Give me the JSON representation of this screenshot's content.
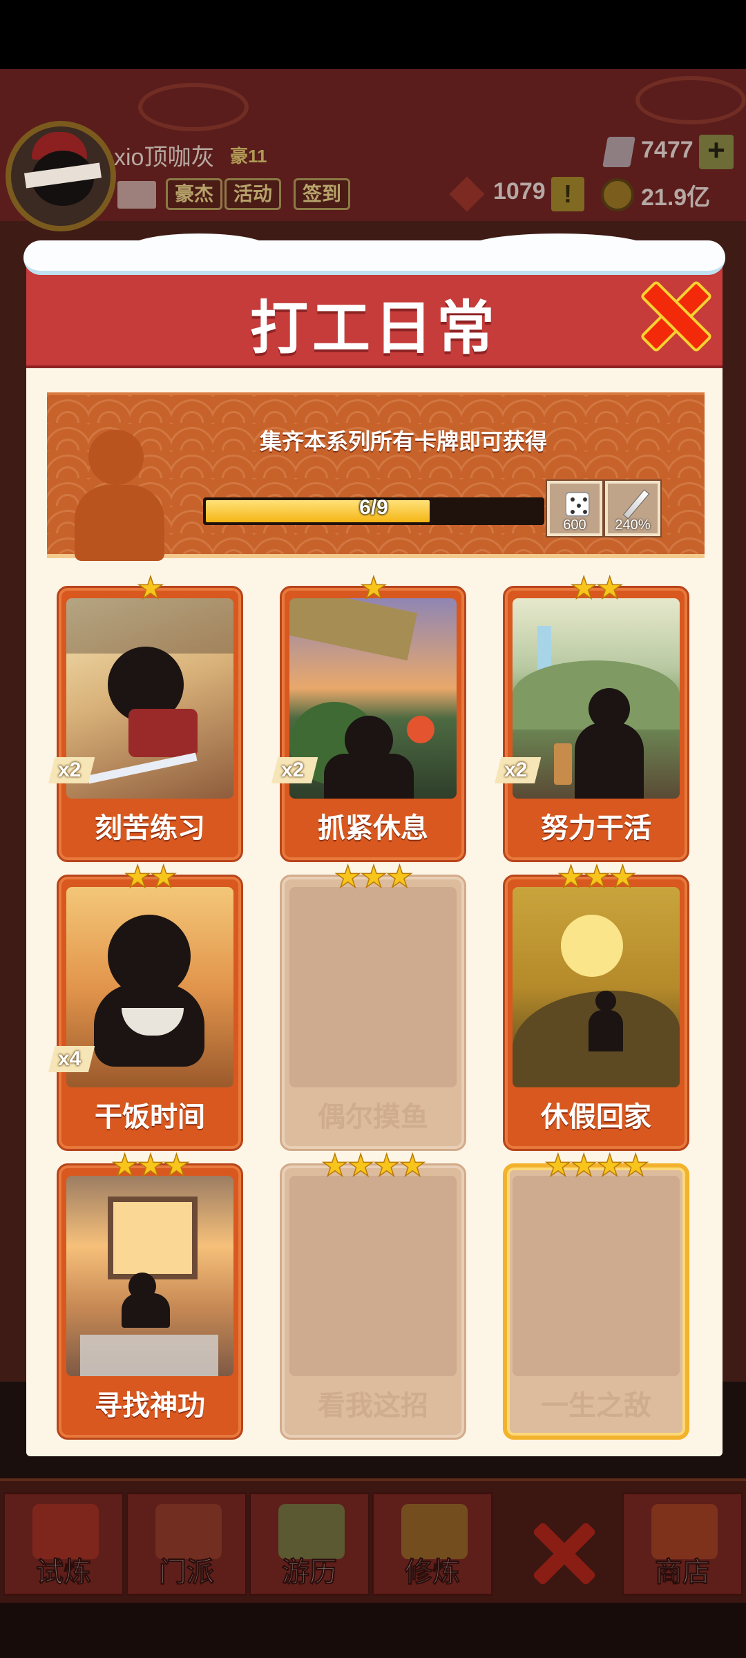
{
  "player": {
    "name": "xio顶咖灰",
    "rank": "豪11",
    "buttons": [
      "豪杰",
      "活动",
      "签到"
    ],
    "gems": "7477",
    "tokens": "1079",
    "gold": "21.9亿"
  },
  "modal": {
    "title": "打工日常",
    "banner_text": "集齐本系列所有卡牌即可获得",
    "progress": {
      "text": "6/9",
      "value": 6,
      "max": 9
    },
    "rewards": [
      {
        "icon": "dice-icon",
        "value": "600"
      },
      {
        "icon": "sword-icon",
        "value": "240%"
      }
    ],
    "cards": [
      {
        "name": "刻苦练习",
        "stars": "★",
        "count": "x2",
        "locked": false
      },
      {
        "name": "抓紧休息",
        "stars": "★",
        "count": "x2",
        "locked": false
      },
      {
        "name": "努力干活",
        "stars": "★★",
        "count": "x2",
        "locked": false
      },
      {
        "name": "干饭时间",
        "stars": "★★",
        "count": "x4",
        "locked": false
      },
      {
        "name": "偶尔摸鱼",
        "stars": "★★★",
        "count": "",
        "locked": true
      },
      {
        "name": "休假回家",
        "stars": "★★★",
        "count": "",
        "locked": false
      },
      {
        "name": "寻找神功",
        "stars": "★★★",
        "count": "",
        "locked": false
      },
      {
        "name": "看我这招",
        "stars": "★★★★",
        "count": "",
        "locked": true
      },
      {
        "name": "一生之敌",
        "stars": "★★★★",
        "count": "",
        "locked": true
      }
    ]
  },
  "bottom_nav": [
    "试炼",
    "门派",
    "游历",
    "修炼",
    "商店"
  ],
  "colors": {
    "header_red": "#c53c3a",
    "card_orange": "#d8581f",
    "star_gold": "#f8c51c",
    "legend_gold": "#f3b22c"
  }
}
